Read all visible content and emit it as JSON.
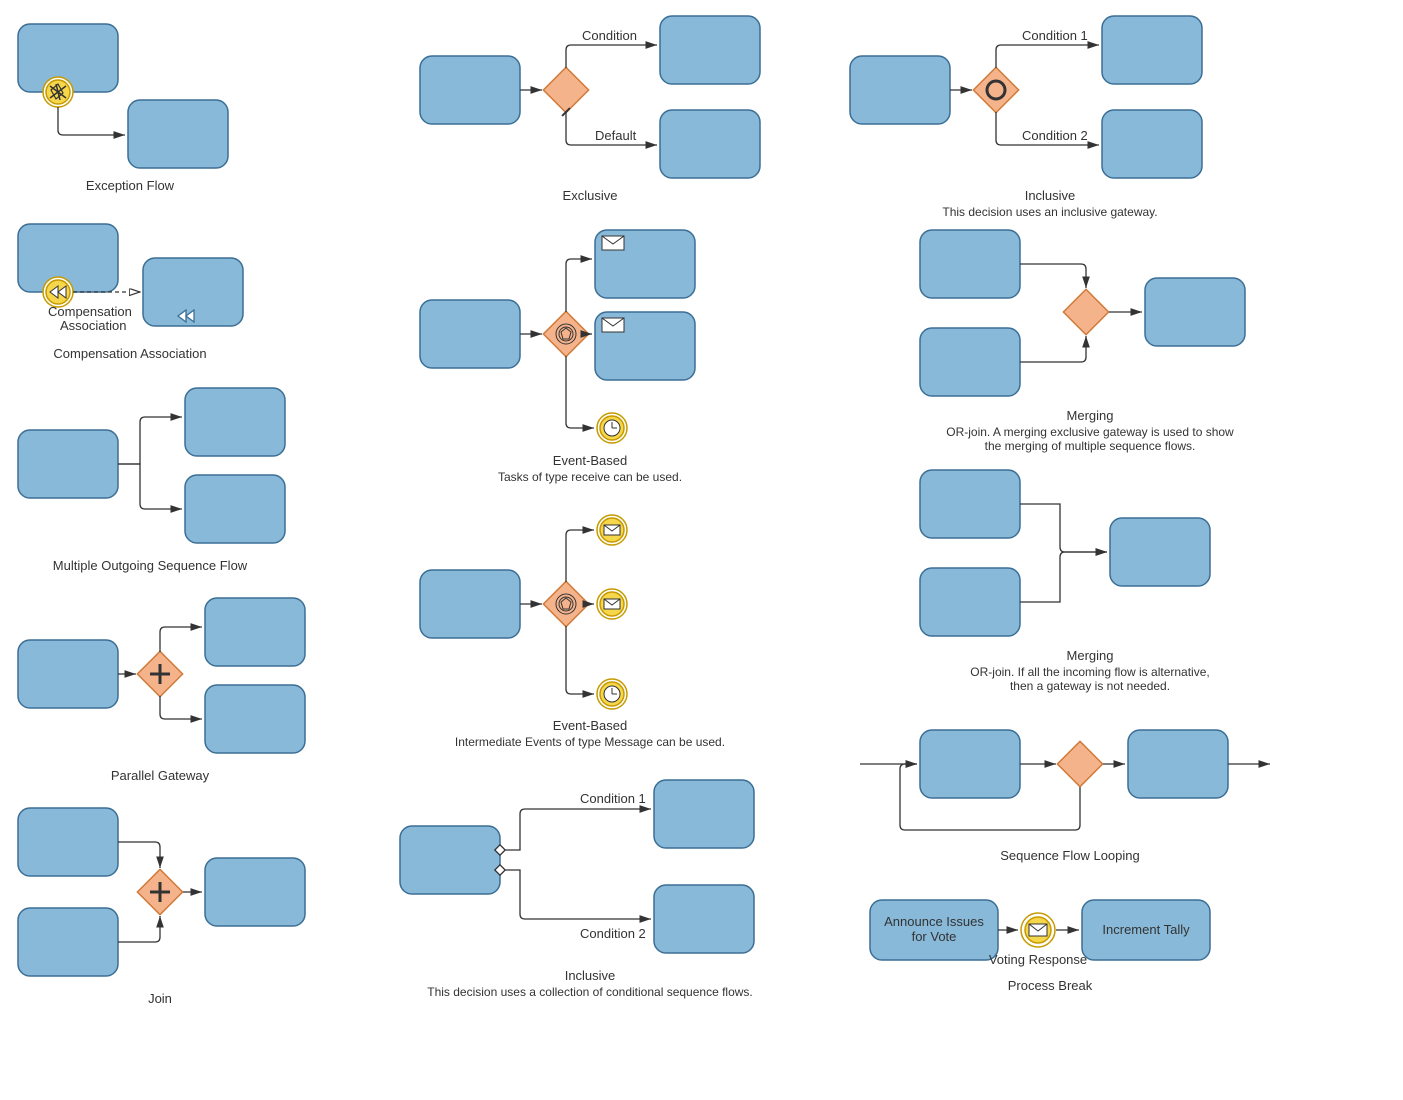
{
  "colors": {
    "task_fill": "#88b9d9",
    "task_stroke": "#3c6f96",
    "gateway_fill": "#f5b38b",
    "gateway_stroke": "#d07b3a",
    "gold_fill": "#f6d64a",
    "gold_stroke": "#c69a00",
    "envelope_fill": "#ffffff"
  },
  "col1": {
    "exception": {
      "title": "Exception Flow"
    },
    "compensation": {
      "arrow_label": "Compensation\nAssociation",
      "title": "Compensation Association"
    },
    "multi_out": {
      "title": "Multiple Outgoing Sequence Flow"
    },
    "parallel": {
      "title": "Parallel Gateway"
    },
    "join": {
      "title": "Join"
    }
  },
  "col2": {
    "exclusive": {
      "top": "Condition",
      "bot": "Default",
      "title": "Exclusive"
    },
    "event1": {
      "title": "Event-Based",
      "sub": "Tasks of type receive can be used."
    },
    "event2": {
      "title": "Event-Based",
      "sub": "Intermediate Events of type Message can be used."
    },
    "inclusive": {
      "c1": "Condition 1",
      "c2": "Condition 2",
      "title": "Inclusive",
      "sub": "This decision uses a collection of conditional sequence flows."
    }
  },
  "col3": {
    "inclusive": {
      "c1": "Condition 1",
      "c2": "Condition 2",
      "title": "Inclusive",
      "sub": "This decision uses an inclusive gateway."
    },
    "merging1": {
      "title": "Merging",
      "sub": "OR-join. A merging exclusive gateway is used to show\nthe merging of multiple sequence flows."
    },
    "merging2": {
      "title": "Merging",
      "sub": "OR-join. If all the incoming flow is alternative,\nthen a gateway is not needed."
    },
    "loop": {
      "title": "Sequence Flow Looping"
    },
    "break": {
      "task1": "Announce Issues\nfor Vote",
      "evt": "Voting Response",
      "task2": "Increment Tally",
      "title": "Process Break"
    }
  }
}
